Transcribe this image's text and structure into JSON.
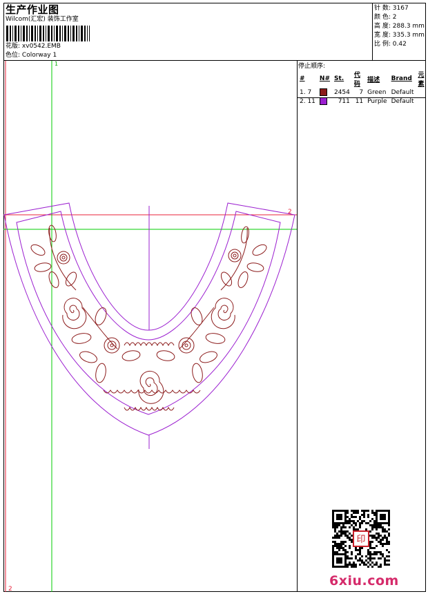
{
  "header": {
    "title": "生产作业图",
    "company": "Wilcom(汇宏) 装饰工作室",
    "design_label": "花版:",
    "design_value": "xv0542.EMB",
    "colorway_label": "色位:",
    "colorway_value": "Colorway 1"
  },
  "stats": [
    {
      "label": "针 数:",
      "value": "3167"
    },
    {
      "label": "颜 色:",
      "value": "2"
    },
    {
      "label": "高 度:",
      "value": "288.3 mm"
    },
    {
      "label": "宽 度:",
      "value": "335.3 mm"
    },
    {
      "label": "比 例:",
      "value": "0.42"
    }
  ],
  "stop_sequence": {
    "title": "停止顺序:",
    "columns": [
      "#",
      "N#",
      "St.",
      "代码",
      "描述",
      "Brand",
      "元素"
    ],
    "rows": [
      {
        "seq": "1. 7",
        "stitches": "2454",
        "code": "7",
        "description": "Green",
        "brand": "Default",
        "color": "#8b1a1a"
      },
      {
        "seq": "2. 11",
        "stitches": "711",
        "code": "11",
        "description": "Purple",
        "brand": "Default",
        "color": "#9b1fd0"
      }
    ]
  },
  "guides": {
    "label_1": "1",
    "label_2_right": "2",
    "label_2_bottom": "2"
  },
  "colors": {
    "thread_1": "#8b1a1a",
    "thread_2": "#9b1fd0",
    "guide_green": "#00cc00",
    "guide_red": "#e8203a"
  },
  "watermark": "6xiu.com",
  "seal_text": "印"
}
